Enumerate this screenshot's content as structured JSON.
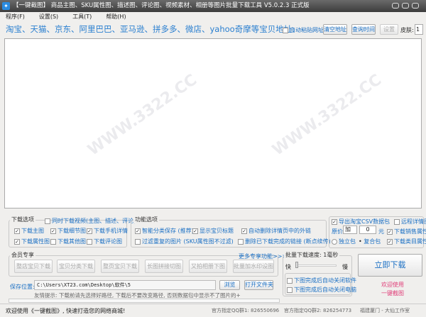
{
  "window": {
    "title": "【一键截图】 商品主图、SKU属性图、描述图、评论图、视频素材、相册等图片批量下载工具 V5.0.2.3 正式版",
    "icon": "app-icon"
  },
  "menu": [
    "程序(F)",
    "设置(S)",
    "工具(T)",
    "帮助(H)"
  ],
  "address": {
    "label": "淘宝、天猫、京东、阿里巴巴、亚马逊、拼多多、微店、yahoo奇摩等宝贝地址:",
    "auto_paste": "自动粘贴网址",
    "clear": "清空地址",
    "query_time": "查询时间",
    "settings": "设置",
    "skin_label": "皮肤:",
    "skin_value": "1",
    "value": ""
  },
  "download_options": {
    "title": "下载选项",
    "video": "同时下载视频(主图、描述、评论)",
    "items": [
      {
        "label": "下载主图",
        "checked": true
      },
      {
        "label": "下载细节图",
        "checked": true
      },
      {
        "label": "下载手机详情",
        "checked": true
      },
      {
        "label": "下载属性图",
        "checked": true
      },
      {
        "label": "下载其他图",
        "checked": false
      },
      {
        "label": "下载评论图",
        "checked": false
      }
    ]
  },
  "function_options": {
    "title": "功能选项",
    "items": [
      {
        "label": "智能分类保存 (推荐)",
        "checked": true
      },
      {
        "label": "显示宝贝标题",
        "checked": true
      },
      {
        "label": "自动删除详情页中的外链",
        "checked": true
      },
      {
        "label": "过滤重复的图片 (SKU属性图不过滤)",
        "checked": false
      },
      {
        "label": "删除已下载完成的链接 (断点续传)",
        "checked": false
      }
    ]
  },
  "csv": {
    "export": "导出淘宝CSV数据包",
    "export_checked": true,
    "remote": "远程详情图",
    "remote_checked": false,
    "price_label": "原价",
    "price_op": "加",
    "price_value": "0",
    "price_unit": "元",
    "sales_attr": "下载销售属性",
    "category_attr": "下载类目属性",
    "standalone": "独立包",
    "combined": "复合包",
    "selected": "combined"
  },
  "member": {
    "title": "会员专享",
    "more": "更多专享功能>>>",
    "buttons": [
      "整店宝贝下载",
      "宝贝分类下载",
      "整页宝贝下载",
      "长图拼接切图",
      "又拍相册下图",
      "批量加水印设图"
    ]
  },
  "speed": {
    "title": "批量下载速度: 1毫秒",
    "fast": "快",
    "slow": "慢",
    "value_ms": 1,
    "close_app": "下图完成后自动关闭软件",
    "shutdown": "下图完成后自动关闭电脑"
  },
  "download_now": "立即下载",
  "welcome": [
    "欢迎使用",
    "一键截图"
  ],
  "save": {
    "label": "保存位置:",
    "path": "C:\\Users\\XT23.com\\Desktop\\软件\\5",
    "browse": "浏览",
    "open_folder": "打开文件夹",
    "hint": "友情提示: 下载前请先选择好路径, 下载后不要改变路径, 否则数据包中显示不了图片的+"
  },
  "status": {
    "welcome": "欢迎使用《一键截图》, 快速打造您的网络商城!",
    "qq1": "官方指定QQ群1: 826550696",
    "qq2": "官方指定QQ群2: 826254773",
    "studio": "福建厦门 - 大仙工作室"
  },
  "colors": {
    "accent": "#1a6fc4",
    "pink": "#e0407a"
  },
  "watermark": "WWW.3322.CC"
}
